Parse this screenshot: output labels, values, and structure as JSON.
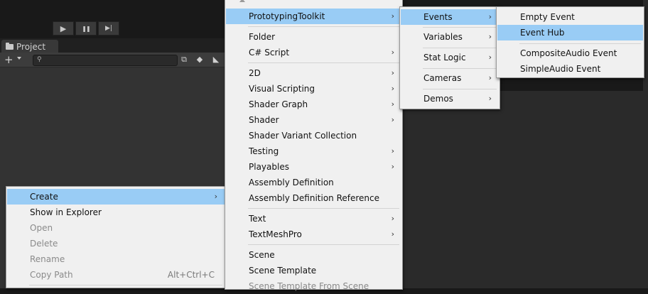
{
  "playbar": {
    "play": "▶",
    "pause": "❚❚",
    "step": "▶|"
  },
  "project": {
    "tab_label": "Project",
    "add_label": "+",
    "search_placeholder": ""
  },
  "context_menu": {
    "items": [
      {
        "label": "Create",
        "has_submenu": true,
        "highlighted": true
      },
      {
        "label": "Show in Explorer"
      },
      {
        "label": "Open",
        "disabled": true
      },
      {
        "label": "Delete",
        "disabled": true
      },
      {
        "label": "Rename",
        "disabled": true
      },
      {
        "label": "Copy Path",
        "disabled": true,
        "shortcut": "Alt+Ctrl+C"
      }
    ]
  },
  "create_menu": {
    "items": [
      {
        "label": "PrototypingToolkit",
        "has_submenu": true,
        "highlighted": true
      },
      {
        "label": "Folder"
      },
      {
        "label": "C# Script",
        "has_submenu": true
      },
      {
        "label": "2D",
        "has_submenu": true
      },
      {
        "label": "Visual Scripting",
        "has_submenu": true
      },
      {
        "label": "Shader Graph",
        "has_submenu": true
      },
      {
        "label": "Shader",
        "has_submenu": true
      },
      {
        "label": "Shader Variant Collection"
      },
      {
        "label": "Testing",
        "has_submenu": true
      },
      {
        "label": "Playables",
        "has_submenu": true
      },
      {
        "label": "Assembly Definition"
      },
      {
        "label": "Assembly Definition Reference"
      },
      {
        "label": "Text",
        "has_submenu": true
      },
      {
        "label": "TextMeshPro",
        "has_submenu": true
      },
      {
        "label": "Scene"
      },
      {
        "label": "Scene Template"
      },
      {
        "label": "Scene Template From Scene"
      }
    ]
  },
  "toolkit_menu": {
    "items": [
      {
        "label": "Events",
        "has_submenu": true,
        "highlighted": true
      },
      {
        "label": "Variables",
        "has_submenu": true
      },
      {
        "label": "Stat Logic",
        "has_submenu": true
      },
      {
        "label": "Cameras",
        "has_submenu": true
      },
      {
        "label": "Demos",
        "has_submenu": true
      }
    ]
  },
  "events_menu": {
    "items": [
      {
        "label": "Empty Event"
      },
      {
        "label": "Event Hub",
        "highlighted": true
      },
      {
        "label": "CompositeAudio Event"
      },
      {
        "label": "SimpleAudio Event"
      }
    ]
  },
  "arrow_glyph": "›"
}
